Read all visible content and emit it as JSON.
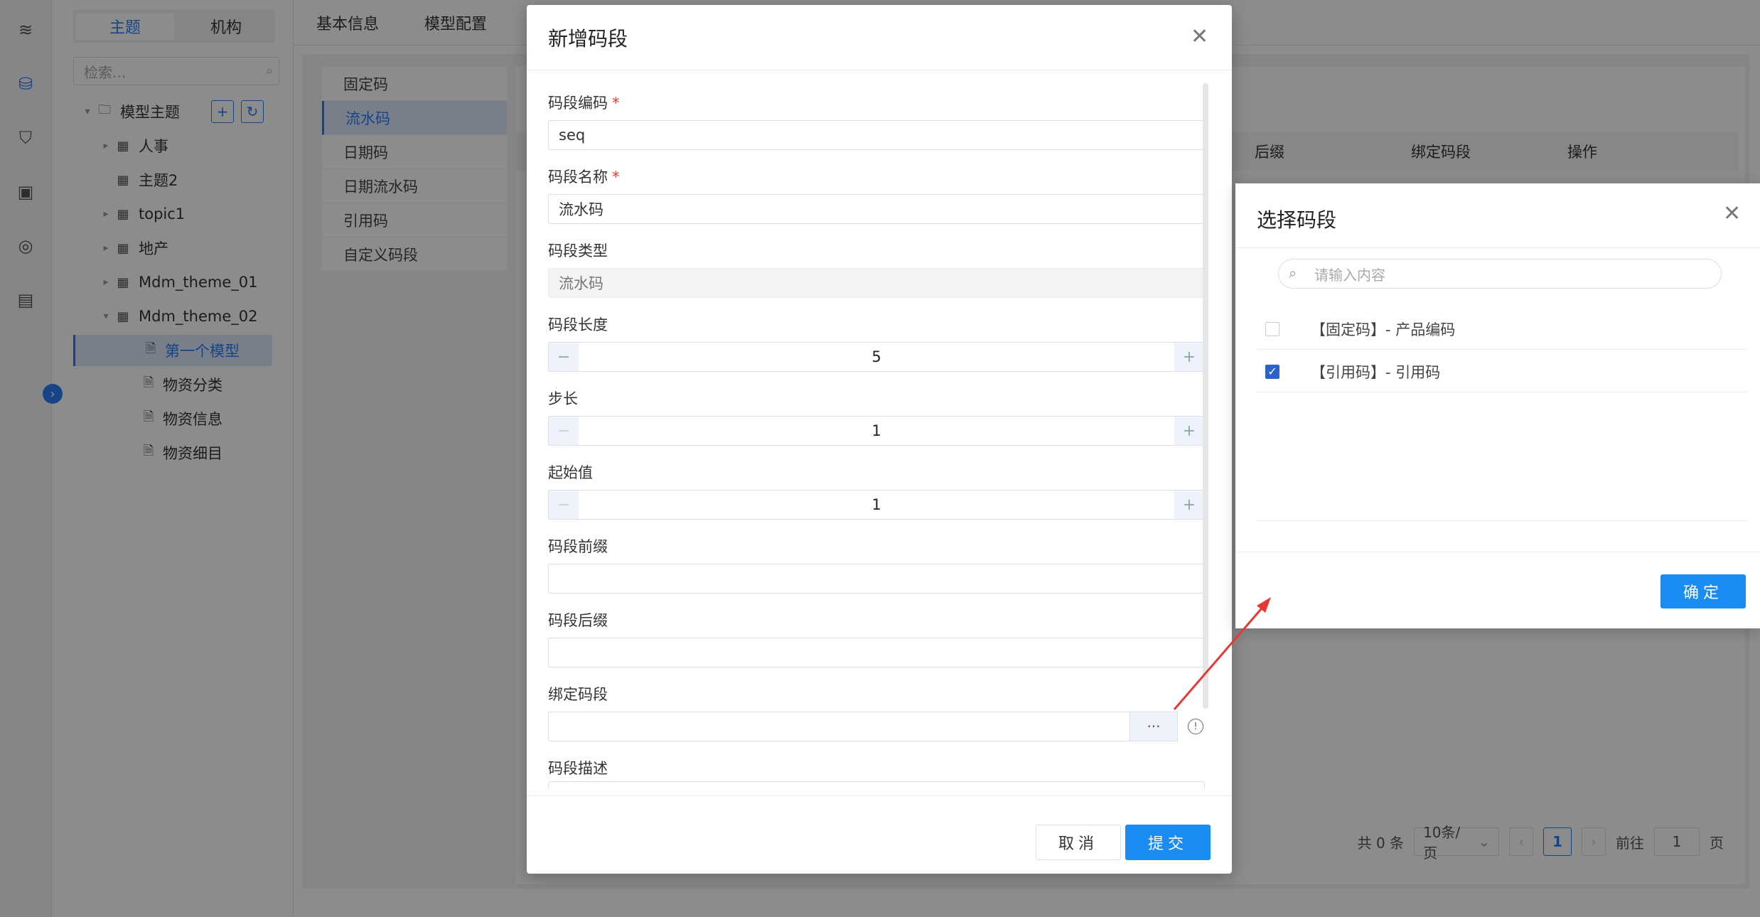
{
  "sidebar": {
    "tabs": [
      "主题",
      "机构"
    ],
    "search_placeholder": "检索...",
    "root": "模型主题",
    "items": [
      {
        "label": "人事"
      },
      {
        "label": "主题2"
      },
      {
        "label": "topic1"
      },
      {
        "label": "地产"
      },
      {
        "label": "Mdm_theme_01"
      },
      {
        "label": "Mdm_theme_02"
      },
      {
        "label": "第一个模型"
      },
      {
        "label": "物资分类"
      },
      {
        "label": "物资信息"
      },
      {
        "label": "物资细目"
      }
    ]
  },
  "top_tabs": [
    "基本信息",
    "模型配置"
  ],
  "code_types": [
    "固定码",
    "流水码",
    "日期码",
    "日期流水码",
    "引用码",
    "自定义码段"
  ],
  "table_headers": [
    "后缀",
    "绑定码段",
    "操作"
  ],
  "pager": {
    "total": "共 0 条",
    "page_size": "10条/页",
    "current": "1",
    "goto_label": "前往",
    "goto_value": "1",
    "page_suffix": "页"
  },
  "dialog": {
    "title": "新增码段",
    "fields": {
      "code_label": "码段编码",
      "code_value": "seq",
      "name_label": "码段名称",
      "name_value": "流水码",
      "type_label": "码段类型",
      "type_value": "流水码",
      "length_label": "码段长度",
      "length_value": "5",
      "step_label": "步长",
      "step_value": "1",
      "start_label": "起始值",
      "start_value": "1",
      "prefix_label": "码段前缀",
      "suffix_label": "码段后缀",
      "bind_label": "绑定码段",
      "desc_label": "码段描述"
    },
    "cancel": "取消",
    "submit": "提交"
  },
  "selector": {
    "title": "选择码段",
    "search_placeholder": "请输入内容",
    "options": [
      {
        "label": "【固定码】- 产品编码",
        "checked": false
      },
      {
        "label": "【引用码】- 引用码",
        "checked": true
      }
    ],
    "confirm": "确定"
  },
  "colors": {
    "primary": "#1a8cf3",
    "arrow": "#e53935"
  }
}
